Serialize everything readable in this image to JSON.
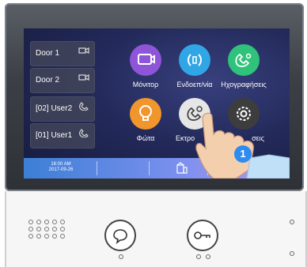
{
  "left_panel": {
    "items": [
      {
        "label": "Door 1",
        "icon": "camera-icon"
      },
      {
        "label": "Door 2",
        "icon": "camera-icon"
      },
      {
        "label": "[02] User2",
        "icon": "handset-icon"
      },
      {
        "label": "[01] User1",
        "icon": "handset-icon"
      }
    ]
  },
  "apps": [
    {
      "label": "Μόνιτορ",
      "icon": "monitor-camera-icon",
      "color": "#8f55d8"
    },
    {
      "label": "Ενδοεπ/νία",
      "icon": "intercom-icon",
      "color": "#31a6e6"
    },
    {
      "label": "Ηχογραφήσεις",
      "icon": "recording-icon",
      "color": "#2fc27b"
    },
    {
      "label": "Φώτα",
      "icon": "lightbulb-icon",
      "color": "#f0962c"
    },
    {
      "label": "Εκτρο",
      "icon": "settings-phone-icon",
      "color": "#e6e6e6"
    },
    {
      "label": "σεις",
      "icon": "gear-icon",
      "color": "#3d3d3d"
    }
  ],
  "status_bar": {
    "time": "16:00 AM",
    "date": "2017-09-26",
    "icons": [
      "building-icon",
      "mute-icon",
      "power-icon"
    ]
  },
  "overlay": {
    "step_badge": "1"
  },
  "device": {
    "buttons": [
      "talk-button",
      "unlock-button"
    ]
  },
  "colors": {
    "status_bar_start": "#3c7fd6",
    "status_bar_end": "#b59ae8",
    "power_icon": "#e8305c"
  }
}
